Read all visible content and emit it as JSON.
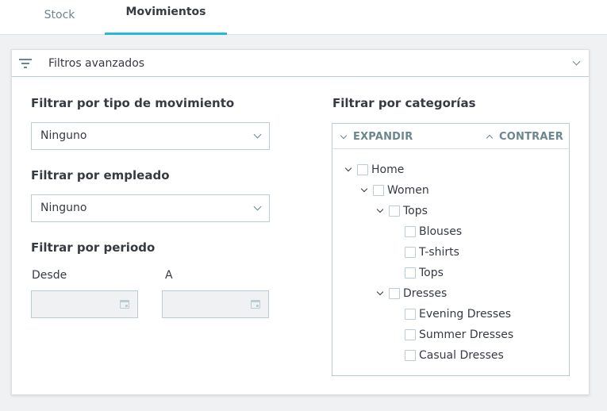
{
  "tabs": [
    {
      "label": "Stock",
      "active": false
    },
    {
      "label": "Movimientos",
      "active": true
    }
  ],
  "colors": {
    "accent": "#25b9d7",
    "text": "#363a41",
    "muted": "#6c868e",
    "border": "#bbcdd2"
  },
  "panel": {
    "title": "Filtros avanzados",
    "icon": "filter-icon",
    "expanded": true
  },
  "filters": {
    "movement_type": {
      "label": "Filtrar por tipo de movimiento",
      "value": "Ninguno"
    },
    "employee": {
      "label": "Filtrar por empleado",
      "value": "Ninguno"
    },
    "period": {
      "label": "Filtrar por periodo",
      "from_label": "Desde",
      "to_label": "A",
      "from_value": "",
      "to_value": ""
    }
  },
  "categories": {
    "label": "Filtrar por categorías",
    "expand_label": "EXPANDIR",
    "collapse_label": "CONTRAER",
    "tree": [
      {
        "label": "Home",
        "depth": 0,
        "expandable": true,
        "checked": false
      },
      {
        "label": "Women",
        "depth": 1,
        "expandable": true,
        "checked": false
      },
      {
        "label": "Tops",
        "depth": 2,
        "expandable": true,
        "checked": false
      },
      {
        "label": "Blouses",
        "depth": 3,
        "expandable": false,
        "checked": false
      },
      {
        "label": "T-shirts",
        "depth": 3,
        "expandable": false,
        "checked": false
      },
      {
        "label": "Tops",
        "depth": 3,
        "expandable": false,
        "checked": false
      },
      {
        "label": "Dresses",
        "depth": 2,
        "expandable": true,
        "checked": false
      },
      {
        "label": "Evening Dresses",
        "depth": 3,
        "expandable": false,
        "checked": false
      },
      {
        "label": "Summer Dresses",
        "depth": 3,
        "expandable": false,
        "checked": false
      },
      {
        "label": "Casual Dresses",
        "depth": 3,
        "expandable": false,
        "checked": false
      }
    ]
  }
}
